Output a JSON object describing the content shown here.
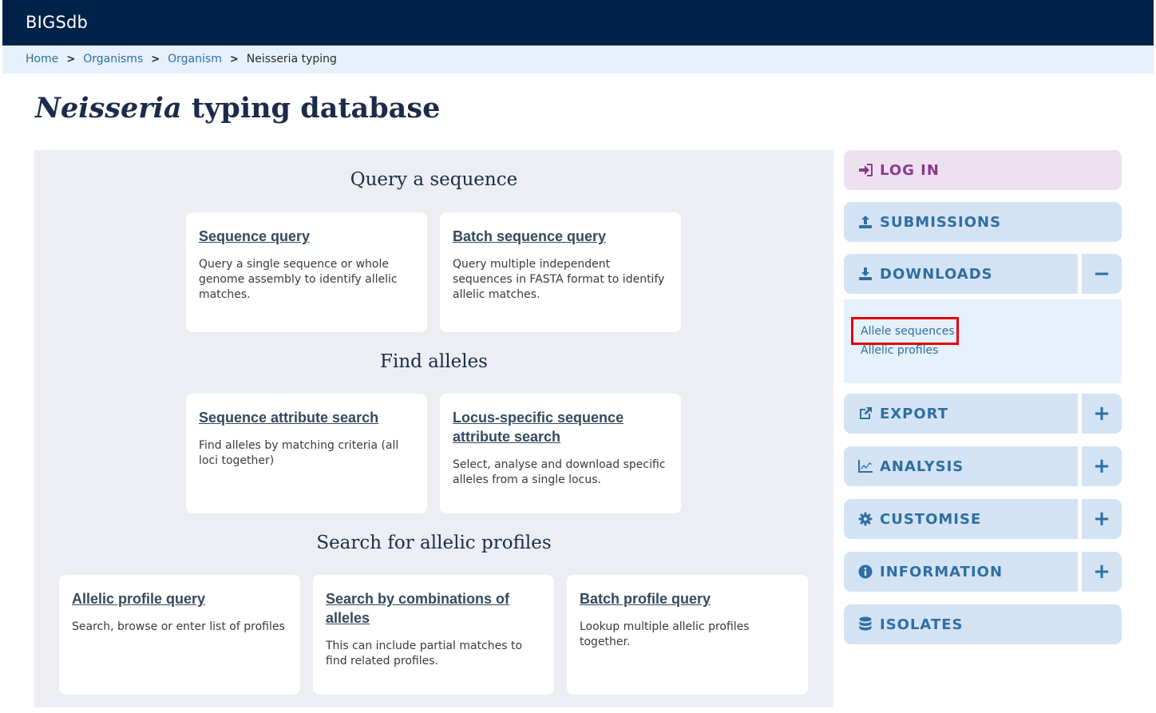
{
  "header": {
    "brand": "BIGSdb"
  },
  "breadcrumb": {
    "items": [
      "Home",
      "Organisms",
      "Organism"
    ],
    "separator": ">",
    "current": "Neisseria typing"
  },
  "page": {
    "title_italic": "Neisseria",
    "title_rest": " typing database"
  },
  "sections": [
    {
      "heading": "Query a sequence",
      "cards": [
        {
          "link": "Sequence query",
          "description": "Query a single sequence or whole genome assembly to identify allelic matches."
        },
        {
          "link": "Batch sequence query",
          "description": "Query multiple independent sequences in FASTA format to identify allelic matches."
        }
      ]
    },
    {
      "heading": "Find alleles",
      "cards": [
        {
          "link": "Sequence attribute search",
          "description": "Find alleles by matching criteria (all loci together)"
        },
        {
          "link": "Locus-specific sequence attribute search",
          "description": "Select, analyse and download specific alleles from a single locus."
        }
      ]
    },
    {
      "heading": "Search for allelic profiles",
      "cards": [
        {
          "link": "Allelic profile query",
          "description": "Search, browse or enter list of profiles"
        },
        {
          "link": "Search by combinations of alleles",
          "description": "This can include partial matches to find related profiles."
        },
        {
          "link": "Batch profile query",
          "description": "Lookup multiple allelic profiles together."
        }
      ]
    }
  ],
  "sidebar": {
    "login": {
      "label": "LOG IN",
      "icon": "sign-in-icon"
    },
    "submissions": {
      "label": "SUBMISSIONS",
      "icon": "upload-icon"
    },
    "downloads": {
      "label": "DOWNLOADS",
      "icon": "download-icon",
      "toggle": "−",
      "expanded": true,
      "links": [
        "Allele sequences",
        "Allelic profiles"
      ],
      "highlighted": "Allele sequences"
    },
    "export": {
      "label": "EXPORT",
      "icon": "external-link-icon",
      "toggle": "+"
    },
    "analysis": {
      "label": "ANALYSIS",
      "icon": "chart-line-icon",
      "toggle": "+"
    },
    "customise": {
      "label": "CUSTOMISE",
      "icon": "gear-icon",
      "toggle": "+"
    },
    "information": {
      "label": "INFORMATION",
      "icon": "info-circle-icon",
      "toggle": "+"
    },
    "isolates": {
      "label": "ISOLATES",
      "icon": "database-icon"
    }
  },
  "colors": {
    "topbar": "#002248",
    "breadcrumb_bg": "#e6f1fc",
    "link": "#2e6fa3",
    "sidebar_button": "#d4e3f4",
    "login_button": "#ede1f0",
    "login_text": "#8a3a8e",
    "highlight": "#e3000f"
  }
}
